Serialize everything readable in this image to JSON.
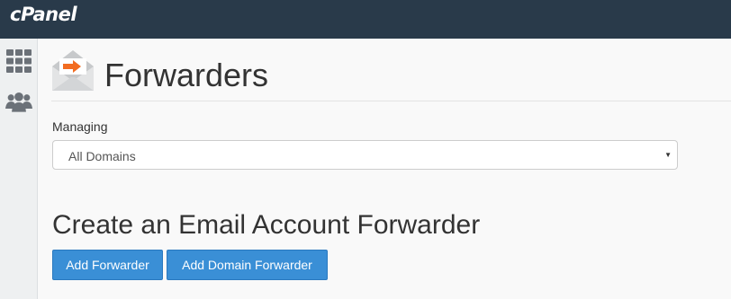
{
  "header": {
    "logo_text": "cPanel",
    "background": "#293a4a"
  },
  "sidebar": {
    "items": [
      {
        "icon": "grid-icon"
      },
      {
        "icon": "users-icon"
      }
    ]
  },
  "page": {
    "icon": "envelope-forward-icon",
    "title": "Forwarders"
  },
  "managing": {
    "label": "Managing",
    "selected_value": "All Domains"
  },
  "section": {
    "title": "Create an Email Account Forwarder"
  },
  "buttons": {
    "add_forwarder": "Add Forwarder",
    "add_domain_forwarder": "Add Domain Forwarder"
  },
  "colors": {
    "button": "#3a8fd6",
    "accent_orange": "#f26c21"
  }
}
